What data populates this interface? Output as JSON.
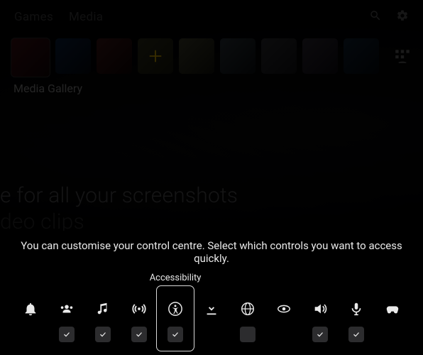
{
  "topbar": {
    "tab1": "Games",
    "tab2": "Media"
  },
  "app_row": {
    "selected_label": "Media Gallery"
  },
  "hero": {
    "line1": "e for all your screenshots",
    "line2": "deo clips"
  },
  "cc": {
    "instruction": "You can customise your control centre. Select which controls you want to access quickly.",
    "selected_label": "Accessibility",
    "items": [
      {
        "id": "notifications",
        "name_icon": "bell-icon",
        "label": "Notifications",
        "checkable": false,
        "checked": false
      },
      {
        "id": "friends",
        "name_icon": "friends-icon",
        "label": "Friends",
        "checkable": true,
        "checked": true
      },
      {
        "id": "music",
        "name_icon": "music-icon",
        "label": "Music",
        "checkable": true,
        "checked": true
      },
      {
        "id": "broadcast",
        "name_icon": "broadcast-icon",
        "label": "Broadcast",
        "checkable": true,
        "checked": true
      },
      {
        "id": "accessibility",
        "name_icon": "accessibility-icon",
        "label": "Accessibility",
        "checkable": true,
        "checked": true
      },
      {
        "id": "downloads",
        "name_icon": "download-icon",
        "label": "Downloads / Uploads",
        "checkable": false,
        "checked": false
      },
      {
        "id": "network",
        "name_icon": "network-icon",
        "label": "Network",
        "checkable": true,
        "checked": false
      },
      {
        "id": "gamebase",
        "name_icon": "gamebase-icon",
        "label": "Game Base",
        "checkable": false,
        "checked": false
      },
      {
        "id": "sound",
        "name_icon": "sound-icon",
        "label": "Sound",
        "checkable": true,
        "checked": true
      },
      {
        "id": "mic",
        "name_icon": "mic-icon",
        "label": "Mic",
        "checkable": true,
        "checked": true
      },
      {
        "id": "controller",
        "name_icon": "controller-small-icon",
        "label": "Accessories",
        "checkable": false,
        "checked": false
      }
    ],
    "selected_index": 4
  }
}
